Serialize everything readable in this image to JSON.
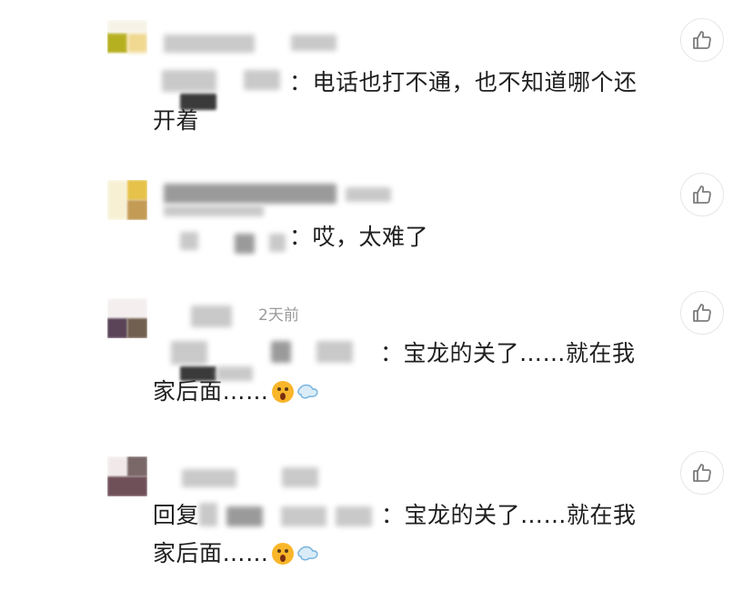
{
  "comments": [
    {
      "text_before": "：电话也打不通，也不知道哪个还开着",
      "timestamp": "",
      "like_icon": "thumbs-up-icon"
    },
    {
      "text_before": "：哎，太难了",
      "timestamp": "",
      "like_icon": "thumbs-up-icon"
    },
    {
      "text_before": "：宝龙的关了……就在我家后面……",
      "timestamp": "2天前",
      "emojis": [
        "surprised-face-emoji",
        "dash-emoji"
      ],
      "like_icon": "thumbs-up-icon"
    },
    {
      "reply_prefix": "回复",
      "text_before": "：宝龙的关了……就在我家后面……",
      "timestamp": "",
      "emojis": [
        "surprised-face-emoji",
        "dash-emoji"
      ],
      "like_icon": "thumbs-up-icon"
    }
  ]
}
